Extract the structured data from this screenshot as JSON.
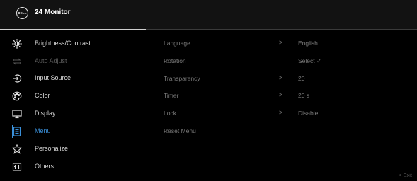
{
  "header": {
    "logo": "DELL",
    "title": "24 Monitor"
  },
  "menu": [
    {
      "label": "Brightness/Contrast",
      "icon": "brightness-icon",
      "state": "normal"
    },
    {
      "label": "Auto Adjust",
      "icon": "auto-adjust-icon",
      "state": "disabled"
    },
    {
      "label": "Input Source",
      "icon": "input-source-icon",
      "state": "normal"
    },
    {
      "label": "Color",
      "icon": "color-icon",
      "state": "normal"
    },
    {
      "label": "Display",
      "icon": "display-icon",
      "state": "normal"
    },
    {
      "label": "Menu",
      "icon": "menu-icon",
      "state": "active"
    },
    {
      "label": "Personalize",
      "icon": "star-icon",
      "state": "normal"
    },
    {
      "label": "Others",
      "icon": "others-icon",
      "state": "normal"
    }
  ],
  "options": [
    {
      "name": "Language",
      "chevron": ">",
      "value": "English"
    },
    {
      "name": "Rotation",
      "chevron": "",
      "value": "Select ✓"
    },
    {
      "name": "Transparency",
      "chevron": ">",
      "value": "20"
    },
    {
      "name": "Timer",
      "chevron": ">",
      "value": "20 s"
    },
    {
      "name": "Lock",
      "chevron": ">",
      "value": "Disable"
    },
    {
      "name": "Reset Menu",
      "chevron": "",
      "value": ""
    }
  ],
  "footer": {
    "exit": "<  Exit"
  },
  "colors": {
    "accent": "#3a8fd8",
    "background": "#000000",
    "header": "#121212"
  }
}
